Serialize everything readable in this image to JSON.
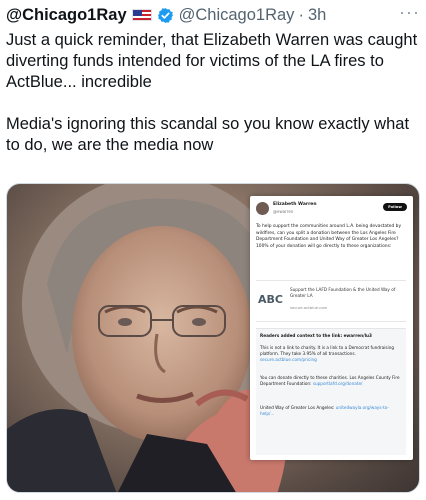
{
  "post": {
    "display_name": "@Chicago1Ray",
    "flag_icon": "us-flag-icon",
    "verified_icon": "verified-badge-icon",
    "verified_color": "#1d9bf0",
    "handle": "@Chicago1Ray",
    "separator": "·",
    "time": "3h",
    "more_icon": "more-options-icon",
    "more_label": "···",
    "text": [
      "Just a quick reminder, that Elizabeth Warren was caught diverting funds intended for victims of the LA fires to ActBlue... incredible",
      "Media's ignoring this scandal so you know exactly what to do, we are the media now"
    ]
  },
  "media": {
    "embedded_post": {
      "name": "Elizabeth Warren",
      "handle": "@ewarren",
      "follow_label": "Follow",
      "body": "To help support the communities around L.A. being devastated by wildfires, can you split a donation between the Los Angeles Fire Department Foundation and United Way of Greater Los Angeles? 100% of your donation will go directly to these organizations:",
      "card": {
        "logo_text": "ABC",
        "title": "Support the LAFD Foundation & the United Way of Greater LA",
        "url": "secure.actblue.com"
      },
      "community_notes": {
        "heading": "Readers added context to the link: ewarren/lu3",
        "note_1": "This is not a link to charity. It is a link to a Democrat fundraising platform. They take 3.95% of all transactions.",
        "note_1_link": "secure.actblue.com/pricing",
        "note_2": "You can donate directly to these charities. Los Angeles County Fire Department Foundation:",
        "note_2_link": "supportlafd.org/donate/",
        "note_3": "United Way of Greater Los Angeles:",
        "note_3_link": "unitedwayla.org/ways-to-help/..."
      }
    }
  }
}
